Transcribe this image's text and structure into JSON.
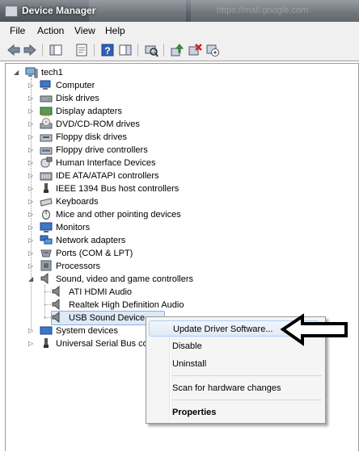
{
  "window": {
    "title": "Device Manager",
    "title_faded": "https://mail.google.com"
  },
  "menu": [
    "File",
    "Action",
    "View",
    "Help"
  ],
  "toolbar_icons": [
    "back-icon",
    "forward-icon",
    "show-hide-console-tree-icon",
    "properties-icon",
    "help-icon",
    "action-pane-icon",
    "scan-hardware-icon",
    "update-driver-icon",
    "uninstall-icon",
    "disable-icon"
  ],
  "tree": {
    "root": "tech1",
    "categories": [
      {
        "label": "Computer",
        "icon": "computer-icon"
      },
      {
        "label": "Disk drives",
        "icon": "disk-drive-icon"
      },
      {
        "label": "Display adapters",
        "icon": "display-adapter-icon"
      },
      {
        "label": "DVD/CD-ROM drives",
        "icon": "dvd-drive-icon"
      },
      {
        "label": "Floppy disk drives",
        "icon": "floppy-drive-icon"
      },
      {
        "label": "Floppy drive controllers",
        "icon": "floppy-controller-icon"
      },
      {
        "label": "Human Interface Devices",
        "icon": "hid-icon"
      },
      {
        "label": "IDE ATA/ATAPI controllers",
        "icon": "ide-controller-icon"
      },
      {
        "label": "IEEE 1394 Bus host controllers",
        "icon": "ieee1394-icon"
      },
      {
        "label": "Keyboards",
        "icon": "keyboard-icon"
      },
      {
        "label": "Mice and other pointing devices",
        "icon": "mouse-icon"
      },
      {
        "label": "Monitors",
        "icon": "monitor-icon"
      },
      {
        "label": "Network adapters",
        "icon": "network-adapter-icon"
      },
      {
        "label": "Ports (COM & LPT)",
        "icon": "port-icon"
      },
      {
        "label": "Processors",
        "icon": "processor-icon"
      },
      {
        "label": "Sound, video and game controllers",
        "icon": "sound-icon",
        "expanded": true
      }
    ],
    "sound_children": [
      "ATI HDMI Audio",
      "Realtek High Definition Audio",
      "USB Sound Device"
    ],
    "after": [
      {
        "label": "System devices",
        "icon": "system-device-icon"
      },
      {
        "label": "Universal Serial Bus con",
        "icon": "usb-icon"
      }
    ]
  },
  "context_menu": {
    "update": "Update Driver Software...",
    "disable": "Disable",
    "uninstall": "Uninstall",
    "scan": "Scan for hardware changes",
    "properties": "Properties"
  },
  "colors": {
    "accent": "#dce9f6",
    "titlebar": "#5d636b"
  }
}
